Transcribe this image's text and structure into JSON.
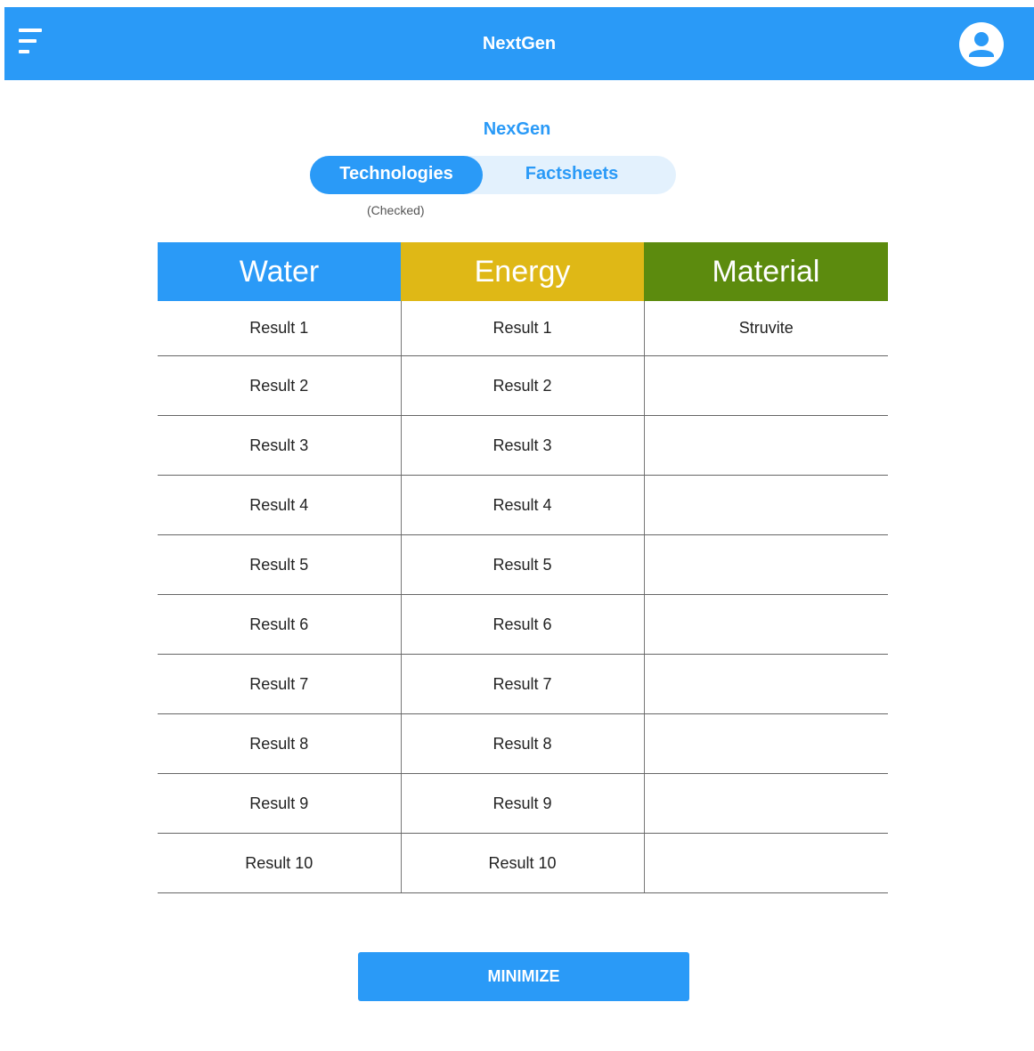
{
  "header": {
    "title": "NextGen",
    "menu_icon": "menu-icon",
    "account_icon": "account-circle-icon"
  },
  "main": {
    "subtitle": "NexGen",
    "tabs": [
      {
        "label": "Technologies",
        "selected": true
      },
      {
        "label": "Factsheets",
        "selected": false
      }
    ],
    "checked_note": "(Checked)"
  },
  "table": {
    "columns": [
      {
        "label": "Water",
        "color": "#2A9AF7"
      },
      {
        "label": "Energy",
        "color": "#DFB816"
      },
      {
        "label": "Material",
        "color": "#5C8B0E"
      }
    ],
    "rows": [
      [
        "Result 1",
        "Result 1",
        "Struvite"
      ],
      [
        "Result 2",
        "Result 2",
        ""
      ],
      [
        "Result 3",
        "Result 3",
        ""
      ],
      [
        "Result 4",
        "Result 4",
        ""
      ],
      [
        "Result 5",
        "Result 5",
        ""
      ],
      [
        "Result 6",
        "Result 6",
        ""
      ],
      [
        "Result 7",
        "Result 7",
        ""
      ],
      [
        "Result 8",
        "Result 8",
        ""
      ],
      [
        "Result 9",
        "Result 9",
        ""
      ],
      [
        "Result 10",
        "Result 10",
        ""
      ]
    ]
  },
  "footer": {
    "minimize_label": "MINIMIZE"
  },
  "colors": {
    "primary": "#2A9AF7",
    "toggle_track": "#E3F1FD"
  }
}
